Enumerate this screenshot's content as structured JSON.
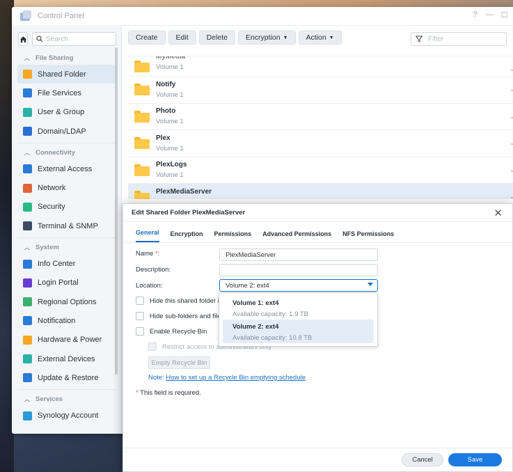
{
  "window": {
    "title": "Control Panel",
    "controls": [
      "?",
      "—",
      "☐"
    ]
  },
  "sidebar": {
    "search_placeholder": "Search",
    "sections": [
      {
        "header": "File Sharing",
        "items": [
          {
            "label": "Shared Folder",
            "icon": "shared-folder-icon",
            "color": "#f5a623",
            "active": true
          },
          {
            "label": "File Services",
            "icon": "file-services-icon",
            "color": "#2b7bd6"
          },
          {
            "label": "User & Group",
            "icon": "user-group-icon",
            "color": "#2bb1a8"
          },
          {
            "label": "Domain/LDAP",
            "icon": "domain-ldap-icon",
            "color": "#2b6fd6"
          }
        ]
      },
      {
        "header": "Connectivity",
        "items": [
          {
            "label": "External Access",
            "icon": "external-access-icon",
            "color": "#2b7bd6"
          },
          {
            "label": "Network",
            "icon": "network-icon",
            "color": "#e0663a"
          },
          {
            "label": "Security",
            "icon": "security-icon",
            "color": "#2bb98a"
          },
          {
            "label": "Terminal & SNMP",
            "icon": "terminal-icon",
            "color": "#3b4b63"
          }
        ]
      },
      {
        "header": "System",
        "items": [
          {
            "label": "Info Center",
            "icon": "info-center-icon",
            "color": "#2b7bd6"
          },
          {
            "label": "Login Portal",
            "icon": "login-portal-icon",
            "color": "#6b3bd6"
          },
          {
            "label": "Regional Options",
            "icon": "regional-options-icon",
            "color": "#3bb06b"
          },
          {
            "label": "Notification",
            "icon": "notification-icon",
            "color": "#2b7bd6"
          },
          {
            "label": "Hardware & Power",
            "icon": "hardware-power-icon",
            "color": "#f5a623"
          },
          {
            "label": "External Devices",
            "icon": "external-devices-icon",
            "color": "#2bb1a8"
          },
          {
            "label": "Update & Restore",
            "icon": "update-restore-icon",
            "color": "#2b7bd6"
          }
        ]
      },
      {
        "header": "Services",
        "items": [
          {
            "label": "Synology Account",
            "icon": "synology-account-icon",
            "color": "#2b9bd6"
          }
        ]
      }
    ]
  },
  "toolbar": {
    "create": "Create",
    "edit": "Edit",
    "delete": "Delete",
    "encryption": "Encryption",
    "action": "Action",
    "filter_placeholder": "Filter"
  },
  "folders": [
    {
      "name": "MyMedia",
      "volume": "Volume 1"
    },
    {
      "name": "Notify",
      "volume": "Volume 1"
    },
    {
      "name": "Photo",
      "volume": "Volume 1"
    },
    {
      "name": "Plex",
      "volume": "Volume 1"
    },
    {
      "name": "PlexLogs",
      "volume": "Volume 1"
    },
    {
      "name": "PlexMediaServer",
      "volume": "Volume 2",
      "selected": true
    }
  ],
  "dialog": {
    "title": "Edit Shared Folder PlexMediaServer",
    "tabs": [
      "General",
      "Encryption",
      "Permissions",
      "Advanced Permissions",
      "NFS Permissions"
    ],
    "name_label": "Name",
    "name_required_mark": "*",
    "name_colon": ":",
    "name_value": "PlexMediaServer",
    "description_label": "Description:",
    "description_value": "",
    "location_label": "Location:",
    "location_value": "Volume 2:  ext4",
    "hide_shared": "Hide this shared folder in \"M",
    "hide_subfolders": "Hide sub-folders and files fr",
    "enable_recycle": "Enable Recycle Bin",
    "restrict_access": "Restrict access to administrators only",
    "empty_recycle": "Empty Recycle Bin",
    "note_prefix": "Note:",
    "note_link": "How to set up a Recycle Bin emptying schedule",
    "required_note": "This field is required.",
    "cancel": "Cancel",
    "save": "Save"
  },
  "location_options": [
    {
      "name": "Volume 1: ext4",
      "capacity": "Available capacity: 1.9 TB"
    },
    {
      "name": "Volume 2: ext4",
      "capacity": "Available capacity: 10.8 TB",
      "selected": true
    }
  ]
}
